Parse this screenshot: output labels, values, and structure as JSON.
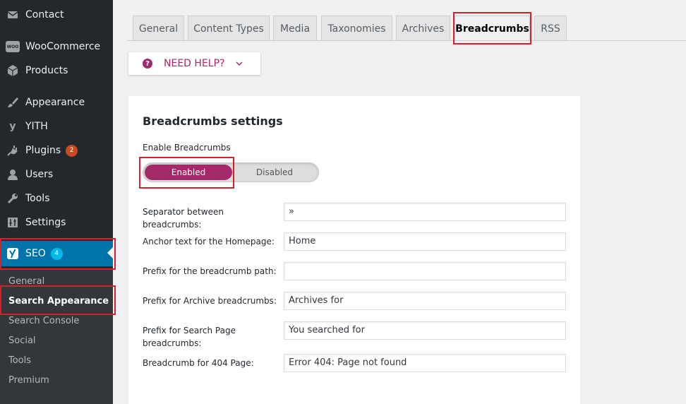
{
  "sidebar": {
    "items": [
      {
        "label": "Contact",
        "icon": "mail-icon"
      },
      {
        "label": "WooCommerce",
        "icon": "woocommerce-icon"
      },
      {
        "label": "Products",
        "icon": "products-box-icon"
      },
      {
        "label": "Appearance",
        "icon": "paintbrush-icon"
      },
      {
        "label": "YITH",
        "icon": "yith-icon"
      },
      {
        "label": "Plugins",
        "icon": "plugin-plug-icon",
        "badge": "2"
      },
      {
        "label": "Users",
        "icon": "users-icon"
      },
      {
        "label": "Tools",
        "icon": "wrench-icon"
      },
      {
        "label": "Settings",
        "icon": "settings-sliders-icon"
      },
      {
        "label": "SEO",
        "icon": "yoast-seo-icon",
        "badge": "4"
      }
    ],
    "woo_icon_text": "WOO",
    "submenu": [
      "General",
      "Search Appearance",
      "Search Console",
      "Social",
      "Tools",
      "Premium"
    ]
  },
  "tabs": [
    "General",
    "Content Types",
    "Media",
    "Taxonomies",
    "Archives",
    "Breadcrumbs",
    "RSS"
  ],
  "help": {
    "label": "NEED HELP?"
  },
  "panel": {
    "title": "Breadcrumbs settings",
    "enable_label": "Enable Breadcrumbs",
    "toggle_on": "Enabled",
    "toggle_off": "Disabled",
    "fields": [
      {
        "label": "Separator between breadcrumbs:",
        "value": "»"
      },
      {
        "label": "Anchor text for the Homepage:",
        "value": "Home"
      },
      {
        "label": "Prefix for the breadcrumb path:",
        "value": ""
      },
      {
        "label": "Prefix for Archive breadcrumbs:",
        "value": "Archives for"
      },
      {
        "label": "Prefix for Search Page breadcrumbs:",
        "value": "You searched for"
      },
      {
        "label": "Breadcrumb for 404 Page:",
        "value": "Error 404: Page not found"
      }
    ]
  },
  "colors": {
    "sidebar_bg": "#23282d",
    "submenu_bg": "#32373c",
    "seo_active": "#0073aa",
    "yoast_accent": "#a4286a",
    "highlight_box": "#d6202a",
    "badge_orange": "#ca4a1f",
    "badge_blue": "#00b9eb"
  }
}
